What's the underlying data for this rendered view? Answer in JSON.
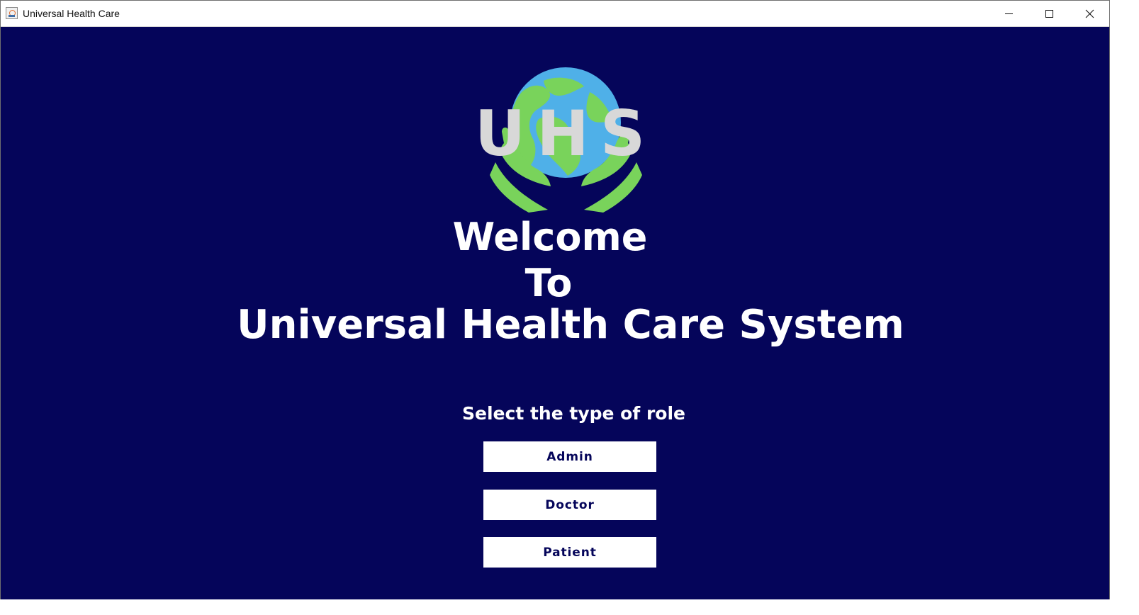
{
  "window": {
    "title": "Universal Health Care",
    "icons": {
      "app": "java-app-icon",
      "minimize": "minimize-icon",
      "maximize": "maximize-icon",
      "close": "close-icon"
    }
  },
  "logo": {
    "text": "UHS",
    "icon": "globe-in-hands-icon",
    "colors": {
      "ocean": "#4fb0e8",
      "land": "#79d35b",
      "hands": "#79d35b",
      "letters": "#d8d8d8"
    }
  },
  "hero": {
    "line1": "Welcome",
    "line2": "To",
    "line3": "Universal Health Care System"
  },
  "roles": {
    "prompt": "Select the type of role",
    "buttons": [
      "Admin",
      "Doctor",
      "Patient"
    ]
  },
  "theme": {
    "background": "#05055a",
    "button_background": "#ffffff",
    "button_text": "#05055a",
    "heading_text": "#ffffff"
  }
}
